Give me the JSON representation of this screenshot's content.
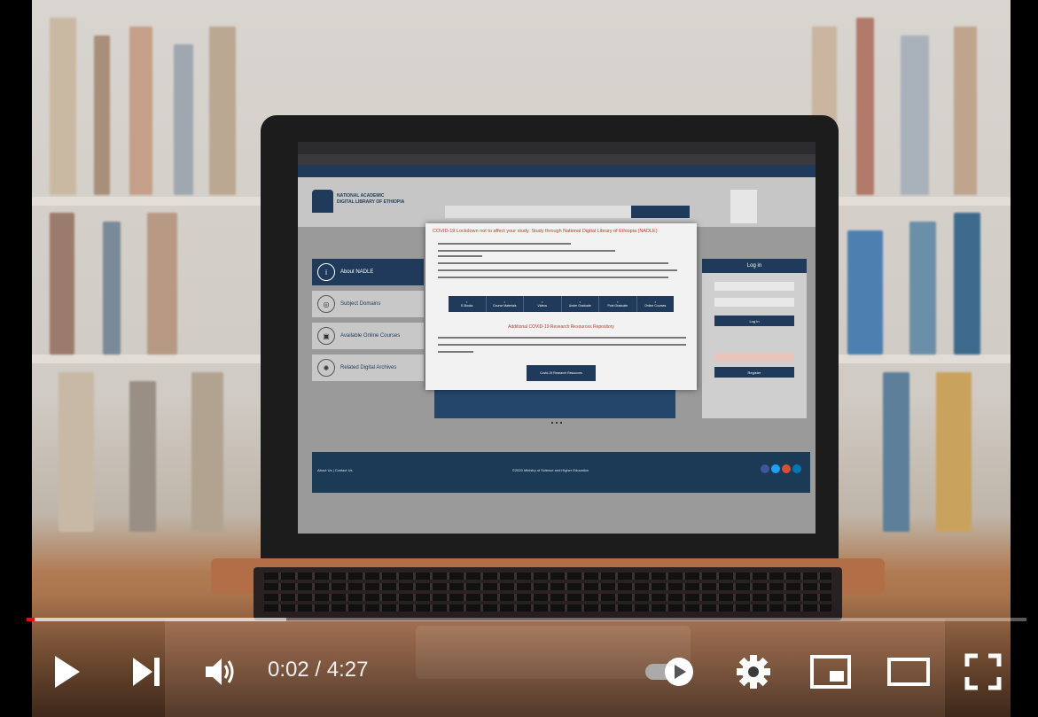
{
  "player": {
    "current_time": "0:02",
    "separator": " / ",
    "duration": "4:27",
    "progress_played": 0.008,
    "progress_loaded": 0.26,
    "autoplay_on": false,
    "accent_color": "#ff0000",
    "icons": [
      "play-icon",
      "next-icon",
      "volume-icon",
      "autoplay-toggle-icon",
      "settings-gear-icon",
      "miniplayer-icon",
      "theater-mode-icon",
      "fullscreen-icon"
    ]
  },
  "site": {
    "logo_line1": "NATIONAL ACADEMIC",
    "logo_line2": "DIGITAL LIBRARY OF ETHIOPIA",
    "menu": [
      {
        "label": "About NADLE",
        "icon": "info-icon"
      },
      {
        "label": "Subject Domains",
        "icon": "domains-icon"
      },
      {
        "label": "Available Online Courses",
        "icon": "courses-icon"
      },
      {
        "label": "Related Digital Archives",
        "icon": "archives-icon"
      }
    ],
    "modal": {
      "title": "COVID-19 Lockdown not to affect your study. Study through National Digital Library of Ethiopia (NADLE)",
      "buttons": [
        "E-Books",
        "Course Materials",
        "Videos",
        "Under Graduate",
        "Post Graduate",
        "Online Courses"
      ],
      "subtitle": "Additional COVID-19 Research Resources Repository",
      "cta": "Covid-19 Research Resources"
    },
    "login": {
      "title": "Log in",
      "button": "Log In",
      "register": "Register"
    },
    "footer": {
      "left": "About Us | Contact Us",
      "center": "©2020 Ministry of Science and Higher Education"
    }
  }
}
